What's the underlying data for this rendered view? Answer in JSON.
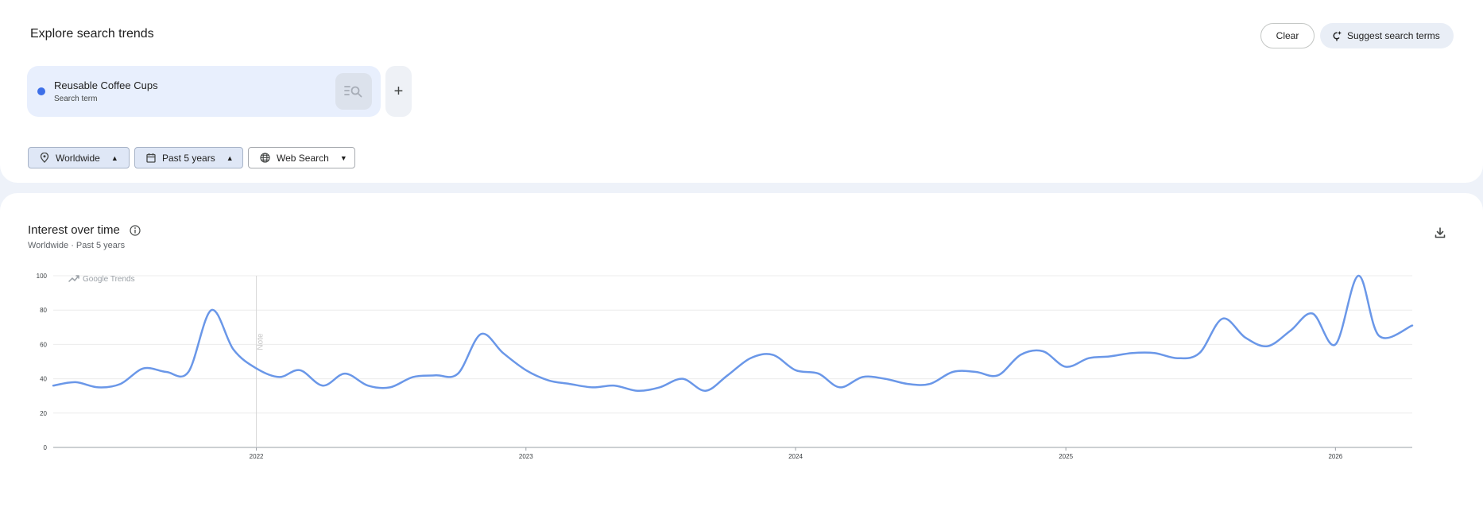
{
  "header": {
    "title": "Explore search trends",
    "clear_label": "Clear",
    "suggest_label": "Suggest search terms"
  },
  "term": {
    "name": "Reusable Coffee Cups",
    "type": "Search term",
    "color": "#3d6fe8"
  },
  "add_term_symbol": "+",
  "filters": {
    "location": "Worldwide",
    "time_range": "Past 5 years",
    "property": "Web Search"
  },
  "section": {
    "title": "Interest over time",
    "subtitle": "Worldwide · Past 5 years"
  },
  "chart_data": {
    "type": "line",
    "watermark": "Google Trends",
    "note_label": "Note",
    "ylim": [
      0,
      100
    ],
    "yticks": [
      0,
      20,
      40,
      60,
      80,
      100
    ],
    "xlim": [
      "2021-04-01",
      "2026-04-15"
    ],
    "xticks": [
      {
        "label": "2022",
        "date": "2022-01-01"
      },
      {
        "label": "2023",
        "date": "2023-01-01"
      },
      {
        "label": "2024",
        "date": "2024-01-01"
      },
      {
        "label": "2025",
        "date": "2025-01-01"
      },
      {
        "label": "2026",
        "date": "2026-01-01"
      }
    ],
    "note_date": "2022-01-01",
    "grid": true,
    "series": [
      {
        "color": "#6a97e8",
        "points": [
          [
            "2021-04-01",
            36
          ],
          [
            "2021-05-01",
            38
          ],
          [
            "2021-06-01",
            35
          ],
          [
            "2021-07-01",
            37
          ],
          [
            "2021-08-01",
            46
          ],
          [
            "2021-09-01",
            44
          ],
          [
            "2021-10-01",
            44
          ],
          [
            "2021-11-01",
            80
          ],
          [
            "2021-12-01",
            57
          ],
          [
            "2022-01-01",
            46
          ],
          [
            "2022-02-01",
            41
          ],
          [
            "2022-03-01",
            45
          ],
          [
            "2022-04-01",
            36
          ],
          [
            "2022-05-01",
            43
          ],
          [
            "2022-06-01",
            36
          ],
          [
            "2022-07-01",
            35
          ],
          [
            "2022-08-01",
            41
          ],
          [
            "2022-09-01",
            42
          ],
          [
            "2022-10-01",
            43
          ],
          [
            "2022-11-01",
            66
          ],
          [
            "2022-12-01",
            55
          ],
          [
            "2023-01-01",
            45
          ],
          [
            "2023-02-01",
            39
          ],
          [
            "2023-03-01",
            37
          ],
          [
            "2023-04-01",
            35
          ],
          [
            "2023-05-01",
            36
          ],
          [
            "2023-06-01",
            33
          ],
          [
            "2023-07-01",
            35
          ],
          [
            "2023-08-01",
            40
          ],
          [
            "2023-09-01",
            33
          ],
          [
            "2023-10-01",
            42
          ],
          [
            "2023-11-01",
            52
          ],
          [
            "2023-12-01",
            54
          ],
          [
            "2024-01-01",
            45
          ],
          [
            "2024-02-01",
            43
          ],
          [
            "2024-03-01",
            35
          ],
          [
            "2024-04-01",
            41
          ],
          [
            "2024-05-01",
            40
          ],
          [
            "2024-06-01",
            37
          ],
          [
            "2024-07-01",
            37
          ],
          [
            "2024-08-01",
            44
          ],
          [
            "2024-09-01",
            44
          ],
          [
            "2024-10-01",
            42
          ],
          [
            "2024-11-01",
            54
          ],
          [
            "2024-12-01",
            56
          ],
          [
            "2025-01-01",
            47
          ],
          [
            "2025-02-01",
            52
          ],
          [
            "2025-03-01",
            53
          ],
          [
            "2025-04-01",
            55
          ],
          [
            "2025-05-01",
            55
          ],
          [
            "2025-06-01",
            52
          ],
          [
            "2025-07-01",
            55
          ],
          [
            "2025-08-01",
            75
          ],
          [
            "2025-09-01",
            64
          ],
          [
            "2025-10-01",
            59
          ],
          [
            "2025-11-01",
            68
          ],
          [
            "2025-12-01",
            78
          ],
          [
            "2026-01-01",
            60
          ],
          [
            "2026-02-01",
            100
          ],
          [
            "2026-03-01",
            65
          ],
          [
            "2026-04-15",
            71
          ]
        ]
      }
    ]
  }
}
